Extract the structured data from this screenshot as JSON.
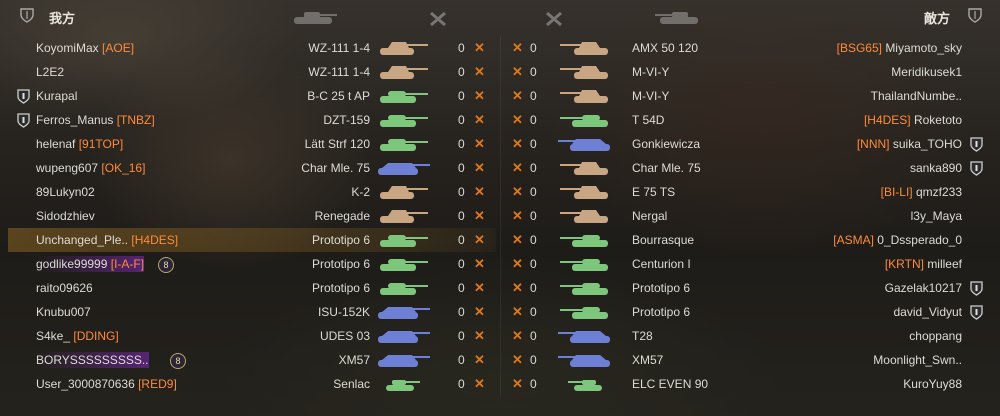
{
  "header": {
    "left_team": "我方",
    "right_team": "敵方"
  },
  "colors": {
    "clan": "#ff8a3a",
    "cross": "#e07818",
    "text": "#dcdcd4",
    "tank_heavy": "#c9a683",
    "tank_medium": "#7cc77b",
    "tank_light": "#7cc77b",
    "tank_td": "#6e7fd6",
    "tank_artillery": "#a0bfbf"
  },
  "left_rows": [
    {
      "player": "KoyomiMax",
      "clan": "[AOE]",
      "vehicle": "WZ-111 1-4",
      "frags": "0",
      "tank": "heavy",
      "badge": false,
      "platoon": "",
      "highlight": false
    },
    {
      "player": "L2E2",
      "clan": "",
      "vehicle": "WZ-111 1-4",
      "frags": "0",
      "tank": "heavy",
      "badge": false,
      "platoon": "",
      "highlight": false
    },
    {
      "player": "Kurapal",
      "clan": "",
      "vehicle": "B-C 25 t AP",
      "frags": "0",
      "tank": "medium",
      "badge": true,
      "platoon": "",
      "highlight": false
    },
    {
      "player": "Ferros_Manus",
      "clan": "[TNBZ]",
      "vehicle": "DZT-159",
      "frags": "0",
      "tank": "medium",
      "badge": true,
      "platoon": "",
      "highlight": false
    },
    {
      "player": "helenaf",
      "clan": "[91TOP]",
      "vehicle": "Lätt Strf 120",
      "frags": "0",
      "tank": "medium",
      "badge": false,
      "platoon": "",
      "highlight": false
    },
    {
      "player": "wupeng607",
      "clan": "[OK_16]",
      "vehicle": "Char Mle. 75",
      "frags": "0",
      "tank": "td",
      "badge": false,
      "platoon": "",
      "highlight": false
    },
    {
      "player": "89Lukyn02",
      "clan": "",
      "vehicle": "K-2",
      "frags": "0",
      "tank": "heavy",
      "badge": false,
      "platoon": "",
      "highlight": false
    },
    {
      "player": "Sidodzhiev",
      "clan": "",
      "vehicle": "Renegade",
      "frags": "0",
      "tank": "heavy",
      "badge": false,
      "platoon": "",
      "highlight": false
    },
    {
      "player": "Unchanged_Ple..",
      "clan": "[H4DES]",
      "vehicle": "Prototipo 6",
      "frags": "0",
      "tank": "medium",
      "badge": false,
      "platoon": "",
      "highlight": true
    },
    {
      "player": "godlike99999",
      "clan": "[I-A-F]",
      "vehicle": "Prototipo 6",
      "frags": "0",
      "tank": "medium",
      "badge": false,
      "platoon": "8",
      "highlight": false
    },
    {
      "player": "raito09626",
      "clan": "",
      "vehicle": "Prototipo 6",
      "frags": "0",
      "tank": "medium",
      "badge": false,
      "platoon": "",
      "highlight": false
    },
    {
      "player": "Knubu007",
      "clan": "",
      "vehicle": "ISU-152K",
      "frags": "0",
      "tank": "td",
      "badge": false,
      "platoon": "",
      "highlight": false
    },
    {
      "player": "S4ke_",
      "clan": "[DDING]",
      "vehicle": "UDES 03",
      "frags": "0",
      "tank": "td",
      "badge": false,
      "platoon": "",
      "highlight": false
    },
    {
      "player": "BORYSSSSSSSSS..",
      "clan": "",
      "vehicle": "XM57",
      "frags": "0",
      "tank": "td",
      "badge": false,
      "platoon": "8",
      "highlight": false
    },
    {
      "player": "User_3000870636",
      "clan": "[RED9]",
      "vehicle": "Senlac",
      "frags": "0",
      "tank": "light",
      "badge": false,
      "platoon": "",
      "highlight": false
    }
  ],
  "right_rows": [
    {
      "player": "Miyamoto_sky",
      "clan": "[BSG65]",
      "vehicle": "AMX 50 120",
      "frags": "0",
      "tank": "heavy",
      "badge": false
    },
    {
      "player": "Meridikusek1",
      "clan": "",
      "vehicle": "M-VI-Y",
      "frags": "0",
      "tank": "heavy",
      "badge": false
    },
    {
      "player": "ThailandNumbe..",
      "clan": "",
      "vehicle": "M-VI-Y",
      "frags": "0",
      "tank": "heavy",
      "badge": false
    },
    {
      "player": "Roketoto",
      "clan": "[H4DES]",
      "vehicle": "T 54D",
      "frags": "0",
      "tank": "medium",
      "badge": false
    },
    {
      "player": "suika_TOHO",
      "clan": "[NNN]",
      "vehicle": "Gonkiewicza",
      "frags": "0",
      "tank": "td",
      "badge": true
    },
    {
      "player": "sanka890",
      "clan": "",
      "vehicle": "Char Mle. 75",
      "frags": "0",
      "tank": "heavy",
      "badge": true
    },
    {
      "player": "qmzf233",
      "clan": "[BI-LI]",
      "vehicle": "E 75 TS",
      "frags": "0",
      "tank": "heavy",
      "badge": false
    },
    {
      "player": "l3y_Maya",
      "clan": "",
      "vehicle": "Nergal",
      "frags": "0",
      "tank": "heavy",
      "badge": false
    },
    {
      "player": "0_Dssperado_0",
      "clan": "[ASMA]",
      "vehicle": "Bourrasque",
      "frags": "0",
      "tank": "medium",
      "badge": false
    },
    {
      "player": "milleef",
      "clan": "[KRTN]",
      "vehicle": "Centurion I",
      "frags": "0",
      "tank": "medium",
      "badge": false
    },
    {
      "player": "Gazelak10217",
      "clan": "",
      "vehicle": "Prototipo 6",
      "frags": "0",
      "tank": "medium",
      "badge": true
    },
    {
      "player": "david_Vidyut",
      "clan": "",
      "vehicle": "Prototipo 6",
      "frags": "0",
      "tank": "medium",
      "badge": true
    },
    {
      "player": "choppang",
      "clan": "",
      "vehicle": "T28",
      "frags": "0",
      "tank": "td",
      "badge": false
    },
    {
      "player": "Moonlight_Swn..",
      "clan": "",
      "vehicle": "XM57",
      "frags": "0",
      "tank": "td",
      "badge": false
    },
    {
      "player": "KuroYuy88",
      "clan": "",
      "vehicle": "ELC EVEN 90",
      "frags": "0",
      "tank": "light",
      "badge": false
    }
  ]
}
